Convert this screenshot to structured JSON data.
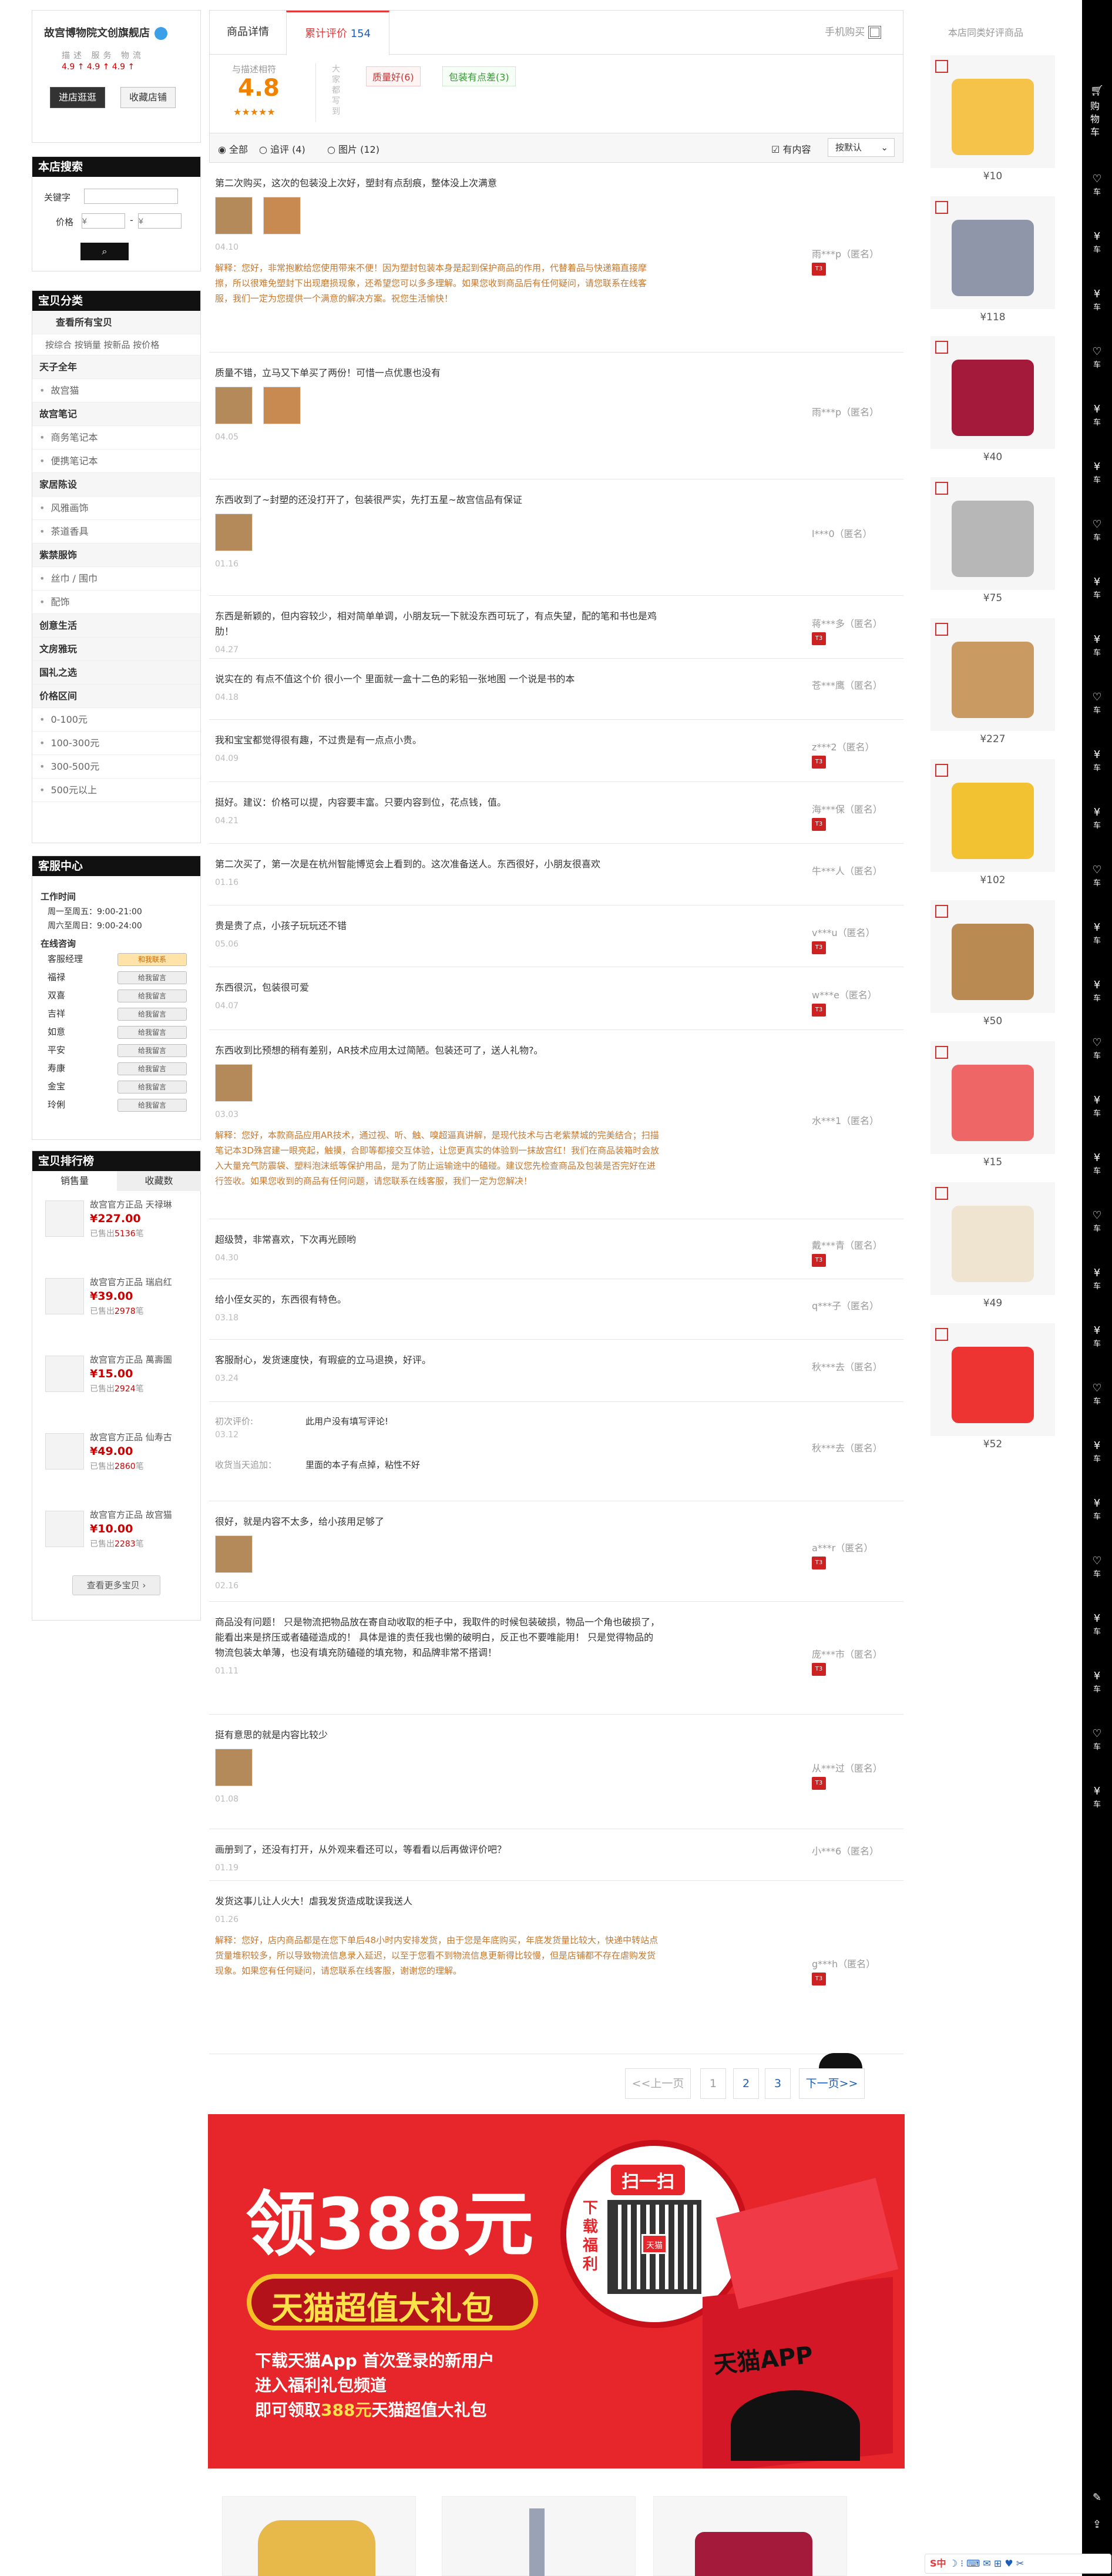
{
  "shop": {
    "name": "故宫博物院文创旗舰店",
    "dsr_labels": "描述  服务  物流",
    "dsr_values": "4.9 ↑   4.9 ↑   4.9 ↑",
    "enter_btn": "进店逛逛",
    "fav_btn": "收藏店铺"
  },
  "search": {
    "title": "本店搜索",
    "keyword_label": "关键字",
    "price_label": "价格",
    "price_min_placeholder": "¥",
    "price_max_placeholder": "¥",
    "dash": "-"
  },
  "category": {
    "title": "宝贝分类",
    "view_all": "查看所有宝贝",
    "sorts": "按综合 按销量 按新品 按价格",
    "items": [
      {
        "label": "天子全年",
        "type": "b"
      },
      {
        "label": "故宫猫",
        "type": "s"
      },
      {
        "label": "故宫笔记",
        "type": "b"
      },
      {
        "label": "商务笔记本",
        "type": "s"
      },
      {
        "label": "便携笔记本",
        "type": "s"
      },
      {
        "label": "家居陈设",
        "type": "b"
      },
      {
        "label": "风雅画饰",
        "type": "s"
      },
      {
        "label": "茶道香具",
        "type": "s"
      },
      {
        "label": "紫禁服饰",
        "type": "b"
      },
      {
        "label": "丝巾 / 围巾",
        "type": "s"
      },
      {
        "label": "配饰",
        "type": "s"
      },
      {
        "label": "创意生活",
        "type": "b"
      },
      {
        "label": "文房雅玩",
        "type": "b"
      },
      {
        "label": "国礼之选",
        "type": "b"
      },
      {
        "label": "价格区间",
        "type": "b"
      },
      {
        "label": "0-100元",
        "type": "s"
      },
      {
        "label": "100-300元",
        "type": "s"
      },
      {
        "label": "300-500元",
        "type": "s"
      },
      {
        "label": "500元以上",
        "type": "s"
      }
    ]
  },
  "service": {
    "title": "客服中心",
    "hours_title": "工作时间",
    "hours1": "周一至周五：9:00-21:00",
    "hours2": "周六至周日：9:00-24:00",
    "online_title": "在线咨询",
    "staff": [
      {
        "name": "客服经理",
        "btn": "和我联系"
      },
      {
        "name": "福禄",
        "btn": "给我留言"
      },
      {
        "name": "双喜",
        "btn": "给我留言"
      },
      {
        "name": "吉祥",
        "btn": "给我留言"
      },
      {
        "name": "如意",
        "btn": "给我留言"
      },
      {
        "name": "平安",
        "btn": "给我留言"
      },
      {
        "name": "寿康",
        "btn": "给我留言"
      },
      {
        "name": "金宝",
        "btn": "给我留言"
      },
      {
        "name": "玲俐",
        "btn": "给我留言"
      }
    ]
  },
  "ranking": {
    "title": "宝贝排行榜",
    "tab_sales": "销售量",
    "tab_fav": "收藏数",
    "sold_prefix": "已售出",
    "sold_suffix": "笔",
    "items": [
      {
        "title": "故宫官方正品 天禄琳",
        "price": "¥227.00",
        "sold": "5136"
      },
      {
        "title": "故宫官方正品 瑞启红",
        "price": "¥39.00",
        "sold": "2978"
      },
      {
        "title": "故宫官方正品 萬壽圖",
        "price": "¥15.00",
        "sold": "2924"
      },
      {
        "title": "故宫官方正品 仙寿古",
        "price": "¥49.00",
        "sold": "2860"
      },
      {
        "title": "故宫官方正品 故宫猫",
        "price": "¥10.00",
        "sold": "2283"
      }
    ],
    "more": "查看更多宝贝"
  },
  "tabs": {
    "detail": "商品详情",
    "reviews": "累计评价",
    "reviews_count": "154",
    "mobile": "手机购买"
  },
  "summary": {
    "label": "与描述相符",
    "score": "4.8",
    "stars": "★★★★★",
    "side_label": "大家都写到",
    "tags": [
      "质量好(6)",
      "包装有点差(3)"
    ]
  },
  "filters": {
    "all": "全部",
    "append": "追评 (4)",
    "image": "图片 (12)",
    "has_content": "有内容",
    "sort": "按默认"
  },
  "reviews": [
    {
      "text": "第二次购买，这次的包装没上次好，塑封有点刮痕，整体没上次满意",
      "date": "04.10",
      "user": "雨***p（匿名）",
      "reply": "解释：您好，非常抱歉给您使用带来不便！因为塑封包装本身是起到保护商品的作用，代替着品与快递箱直接摩擦，所以很难免塑封下出现磨损现象，还希望您可以多多理解。如果您收到商品后有任何疑问，请您联系在线客服，我们一定为您提供一个满意的解决方案。祝您生活愉快！"
    },
    {
      "text": "质量不错，立马又下单买了两份！可惜一点优惠也没有",
      "date": "04.05",
      "user": "雨***p（匿名）"
    },
    {
      "text": "东西收到了~封塑的还没打开了，包装很严实，先打五星~故宫信品有保证",
      "date": "01.16",
      "user": "l***0（匿名）"
    },
    {
      "text": "东西是新颖的，但内容较少，相对简单单调，小朋友玩一下就没东西可玩了，有点失望，配的笔和书也是鸡肋！",
      "date": "04.27",
      "user": "蒋***多（匿名）"
    },
    {
      "text": "说实在的 有点不值这个价 很小一个 里面就一盒十二色的彩铅一张地图 一个说是书的本",
      "date": "04.18",
      "user": "苍***鹰（匿名）"
    },
    {
      "text": "我和宝宝都觉得很有趣，不过贵是有一点点小贵。",
      "date": "04.09",
      "user": "z***2（匿名）"
    },
    {
      "text": "挺好。建议：价格可以提，内容要丰富。只要内容到位，花点钱，值。",
      "date": "04.21",
      "user": "海***保（匿名）"
    },
    {
      "text": "第二次买了，第一次是在杭州智能博览会上看到的。这次准备送人。东西很好，小朋友很喜欢",
      "date": "01.16",
      "user": "牛***人（匿名）"
    },
    {
      "text": "贵是贵了点，小孩子玩玩还不错",
      "date": "05.06",
      "user": "v***u（匿名）"
    },
    {
      "text": "东西很沉，包装很可爱",
      "date": "04.07",
      "user": "w***e（匿名）"
    },
    {
      "text": "东西收到比预想的稍有差别，AR技术应用太过简陋。包装还可了，送人礼物?。",
      "date": "03.03",
      "user": "水***1（匿名）",
      "reply": "解释：您好，本款商品应用AR技术，通过视、听、触、嗅超逼真讲解，是现代技术与古老紫禁城的完美结合；扫描笔记本3D殊宫建一眼亮起，触摸，合即等都接交互体验，让您更真实的体验到一抹故宫红！我们在商品装箱时会放入大量充气防震袋、塑料泡沫纸等保护用品，是为了防止运输途中的磕碰。建议您先检查商品及包装是否完好在进行签收。如果您收到的商品有任何问题，请您联系在线客服，我们一定为您解决！"
    },
    {
      "text": "超级赞，非常喜欢，下次再光顾哟",
      "date": "04.30",
      "user": "戴***青（匿名）"
    },
    {
      "text": "给小侄女买的，东西很有特色。",
      "date": "03.18",
      "user": "q***子（匿名）"
    },
    {
      "text": "客服耐心，发货速度快，有瑕疵的立马退换，好评。",
      "date": "03.24",
      "user": "秋***去（匿名）"
    },
    {
      "text": "此用户没有填写评论!",
      "date": "03.12",
      "user": "秋***去（匿名）",
      "first_label": "初次评价:",
      "append_label": "收货当天追加：",
      "append": "里面的本子有点掉，粘性不好"
    },
    {
      "text": "很好，就是内容不太多，给小孩用足够了",
      "date": "02.16",
      "user": "a***r（匿名）"
    },
    {
      "text": "商品没有问题！ 只是物流把物品放在寄自动收取的柜子中，我取件的时候包装破损，物品一个角也破损了，能看出来是挤压或者磕碰造成的！ 具体是谁的责任我也懒的破明白，反正也不要唯能用！ 只是觉得物品的物流包装太单薄，也没有填充防磕碰的填充物，和品牌非常不搭调！",
      "date": "01.11",
      "user": "庞***市（匿名）"
    },
    {
      "text": "挺有意思的就是内容比较少",
      "date": "01.08",
      "user": "从***过（匿名）"
    },
    {
      "text": "画册到了，还没有打开，从外观来看还可以，等看看以后再做评价吧？",
      "date": "01.19",
      "user": "小***6（匿名）"
    },
    {
      "text": "发货这事儿让人火大！虐我发货造成耽误我送人",
      "date": "01.26",
      "user": "g***h（匿名）",
      "reply": "解释：您好，店内商品都是在您下单后48小时内安排发货，由于您是年底购买，年底发货量比较大，快递中转站点货量堆积较多，所以导致物流信息录入延迟，以至于您看不到物流信息更新得比较慢，但是店铺都不存在虐购发货现象。如果您有任何疑问，请您联系在线客服，谢谢您的理解。"
    }
  ],
  "pager": {
    "prev": "<<上一页",
    "pages": [
      "1",
      "2",
      "3"
    ],
    "next": "下一页>>"
  },
  "banner": {
    "headline": "领388元",
    "subhead": "天猫超值大礼包",
    "scan": "扫一扫",
    "scan_side": "下载福利",
    "tmall_label": "天猫",
    "box_label": "天猫APP",
    "line1": "下载天猫App 首次登录的新用户",
    "line2": "进入福利礼包频道",
    "line3a": "即可领取",
    "line3b": "388元",
    "line3c": "天猫超值大礼包"
  },
  "recommend": {
    "title": "本店同类好评商品",
    "items": [
      "¥10",
      "¥118",
      "¥40",
      "¥75",
      "¥227",
      "¥102",
      "¥50",
      "¥15",
      "¥49",
      "¥52"
    ]
  },
  "toolbar": {
    "cart": "购物车",
    "items": [
      "车",
      "车",
      "车",
      "车",
      "车",
      "车",
      "车",
      "车",
      "车",
      "车",
      "车",
      "车",
      "车",
      "车",
      "车",
      "车",
      "车",
      "车",
      "车",
      "车",
      "车",
      "车",
      "车",
      "车",
      "车",
      "车",
      "车",
      "车",
      "车"
    ]
  },
  "ime": {
    "label": "S中"
  },
  "colors": {
    "accent": "#e4393c",
    "tmall_red": "#e6262a",
    "dark": "#111111",
    "score_orange": "#f08200"
  }
}
